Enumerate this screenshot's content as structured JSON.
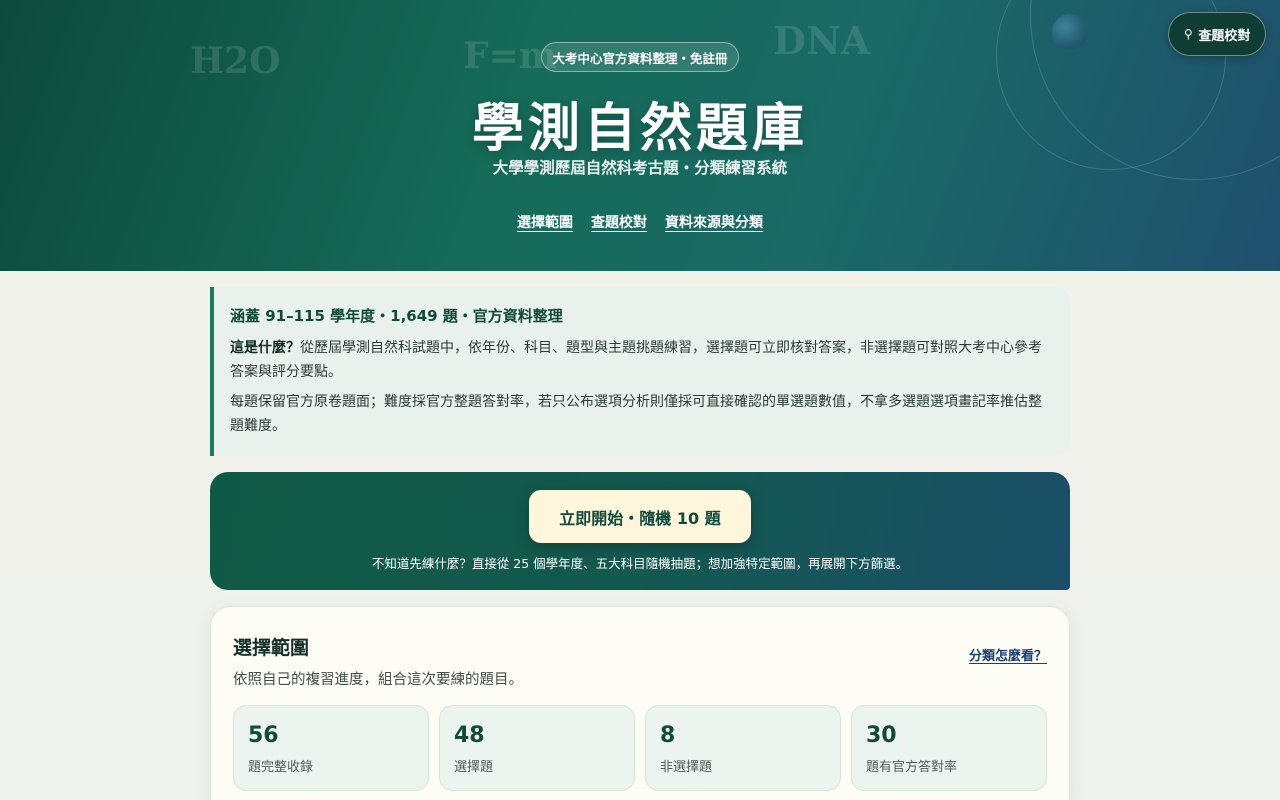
{
  "hero": {
    "deco": [
      "H2O",
      "F=m",
      "DNA"
    ],
    "badge": "大考中心官方資料整理・免註冊",
    "title": "學測自然題庫",
    "subtitle": "大學學測歷屆自然科考古題・分類練習系統",
    "nav": [
      "選擇範圍",
      "查題校對",
      "資料來源與分類"
    ],
    "search_button": "查題校對",
    "search_icon": "search-icon"
  },
  "info": {
    "headline": "涵蓋 91–115 學年度・1,649 題・官方資料整理",
    "q_label": "這是什麼？",
    "p1": "從歷屆學測自然科試題中，依年份、科目、題型與主題挑題練習，選擇題可立即核對答案，非選擇題可對照大考中心參考答案與評分要點。",
    "p2": "每題保留官方原卷題面；難度採官方整題答對率，若只公布選項分析則僅採可直接確認的單選題數值，不拿多選題選項畫記率推估整題難度。"
  },
  "cta": {
    "button": "立即開始・隨機 10 題",
    "note": "不知道先練什麼？直接從 25 個學年度、五大科目隨機抽題；想加強特定範圍，再展開下方篩選。"
  },
  "panel": {
    "title": "選擇範圍",
    "subtitle": "依照自己的複習進度，組合這次要練的題目。",
    "help_link": "分類怎麼看？",
    "stats": [
      {
        "value": "56",
        "label": "題完整收錄"
      },
      {
        "value": "48",
        "label": "選擇題"
      },
      {
        "value": "8",
        "label": "非選擇題"
      },
      {
        "value": "30",
        "label": "題有官方答對率"
      }
    ]
  },
  "colors": {
    "hero_start": "#0d4a3d",
    "hero_end": "#1f4f6e",
    "accent": "#1d7a5e",
    "cta_button_bg": "#fff6dc"
  }
}
